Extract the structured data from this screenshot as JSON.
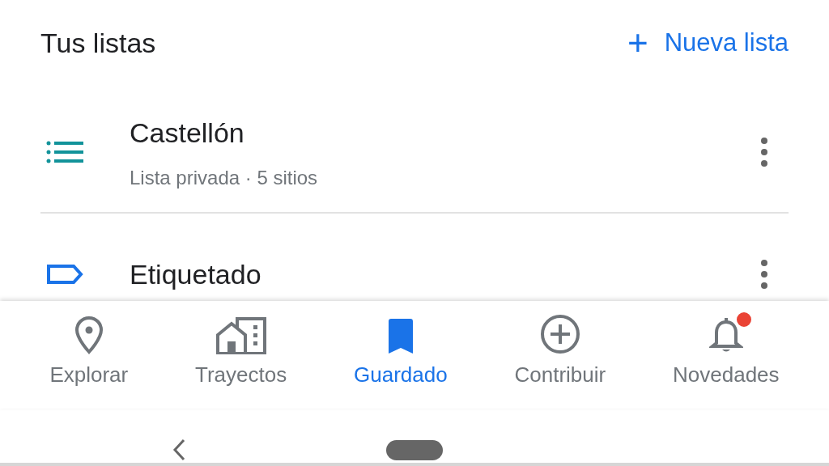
{
  "header": {
    "title": "Tus listas",
    "action": {
      "icon": "+",
      "label": "Nueva lista"
    }
  },
  "lists": [
    {
      "kind": "list",
      "title": "Castellón",
      "subtitle": "Lista privada · 5 sitios"
    },
    {
      "kind": "label",
      "title": "Etiquetado"
    }
  ],
  "bottom_nav": [
    {
      "kind": "explore",
      "label": "Explorar",
      "selected": false,
      "badge": false
    },
    {
      "kind": "commute",
      "label": "Trayectos",
      "selected": false,
      "badge": false
    },
    {
      "kind": "saved",
      "label": "Guardado",
      "selected": true,
      "badge": false
    },
    {
      "kind": "contribute",
      "label": "Contribuir",
      "selected": false,
      "badge": false
    },
    {
      "kind": "updates",
      "label": "Novedades",
      "selected": false,
      "badge": true
    }
  ]
}
